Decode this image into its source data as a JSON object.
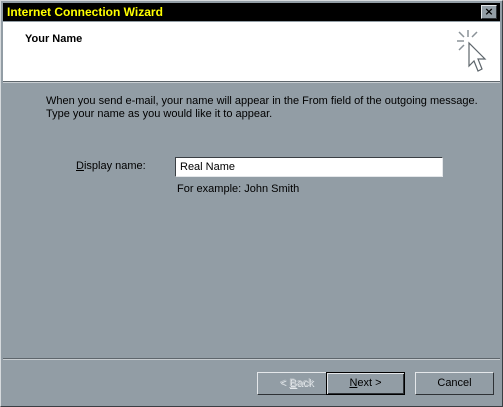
{
  "window": {
    "title": "Internet Connection Wizard",
    "close_glyph": "×"
  },
  "header": {
    "title": "Your Name",
    "icon": "wizard-cursor-sparkle-icon"
  },
  "body": {
    "intro_line1": "When you send e-mail, your name will appear in the From field of the outgoing message.",
    "intro_line2": "Type your name as you would like it to appear.",
    "display_name_label_accel": "D",
    "display_name_label_rest": "isplay name:",
    "display_name_value": "Real Name",
    "example_text": "For example: John Smith"
  },
  "buttons": {
    "back_prefix": "< ",
    "back_accel": "B",
    "back_rest": "ack",
    "next_accel": "N",
    "next_rest": "ext >",
    "cancel": "Cancel"
  },
  "colors": {
    "dialog_bg": "#929DA5",
    "titlebar_bg": "#000000",
    "title_text": "#FFFF00",
    "header_bg": "#FFFFFF"
  }
}
